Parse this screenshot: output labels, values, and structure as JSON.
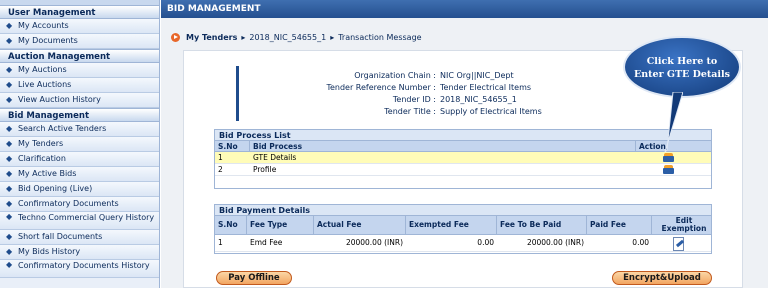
{
  "sidebar": {
    "sections": [
      {
        "title": "User Management",
        "items": [
          "My Accounts",
          "My Documents"
        ]
      },
      {
        "title": "Auction Management",
        "items": [
          "My Auctions",
          "Live Auctions",
          "View Auction History"
        ]
      },
      {
        "title": "Bid Management",
        "items": [
          "Search Active Tenders",
          "My Tenders",
          "Clarification",
          "My Active Bids",
          "Bid Opening (Live)",
          "Confirmatory Documents",
          "Techno Commercial Query History",
          "Short fall Documents",
          "My Bids History",
          "Confirmatory Documents History"
        ]
      }
    ]
  },
  "header": {
    "title": "BID MANAGEMENT"
  },
  "breadcrumb": {
    "root": "My Tenders",
    "level2": "2018_NIC_54655_1",
    "level3": "Transaction Message"
  },
  "tender_info": {
    "org_chain_label": "Organization Chain :",
    "org_chain_value": "NIC Org||NIC_Dept",
    "ref_label": "Tender Reference Number :",
    "ref_value": "Tender Electrical Items",
    "id_label": "Tender ID :",
    "id_value": "2018_NIC_54655_1",
    "title_label": "Tender Title :",
    "title_value": "Supply of Electrical Items"
  },
  "bid_process": {
    "title": "Bid Process List",
    "headers": {
      "sno": "S.No",
      "process": "Bid Process",
      "action": "Action"
    },
    "rows": [
      {
        "sno": "1",
        "process": "GTE Details"
      },
      {
        "sno": "2",
        "process": "Profile"
      }
    ]
  },
  "bid_payment": {
    "title": "Bid Payment Details",
    "headers": {
      "sno": "S.No",
      "fee_type": "Fee Type",
      "actual_fee": "Actual Fee",
      "exempted_fee": "Exempted Fee",
      "to_be_paid": "Fee To Be Paid",
      "paid_fee": "Paid Fee",
      "edit": "Edit Exemption"
    },
    "rows": [
      {
        "sno": "1",
        "fee_type": "Emd Fee",
        "actual_fee": "20000.00 (INR)",
        "exempted_fee": "0.00",
        "to_be_paid": "20000.00 (INR)",
        "paid_fee": "0.00"
      }
    ]
  },
  "buttons": {
    "pay_offline": "Pay Offline",
    "encrypt_upload": "Encrypt&Upload"
  },
  "callout": {
    "line1": "Click Here to",
    "line2": "Enter GTE Details"
  },
  "colors": {
    "header_blue": "#244f8f",
    "highlight_row": "#fffcb8",
    "button_orange": "#f2a562",
    "callout_blue": "#123a78"
  }
}
